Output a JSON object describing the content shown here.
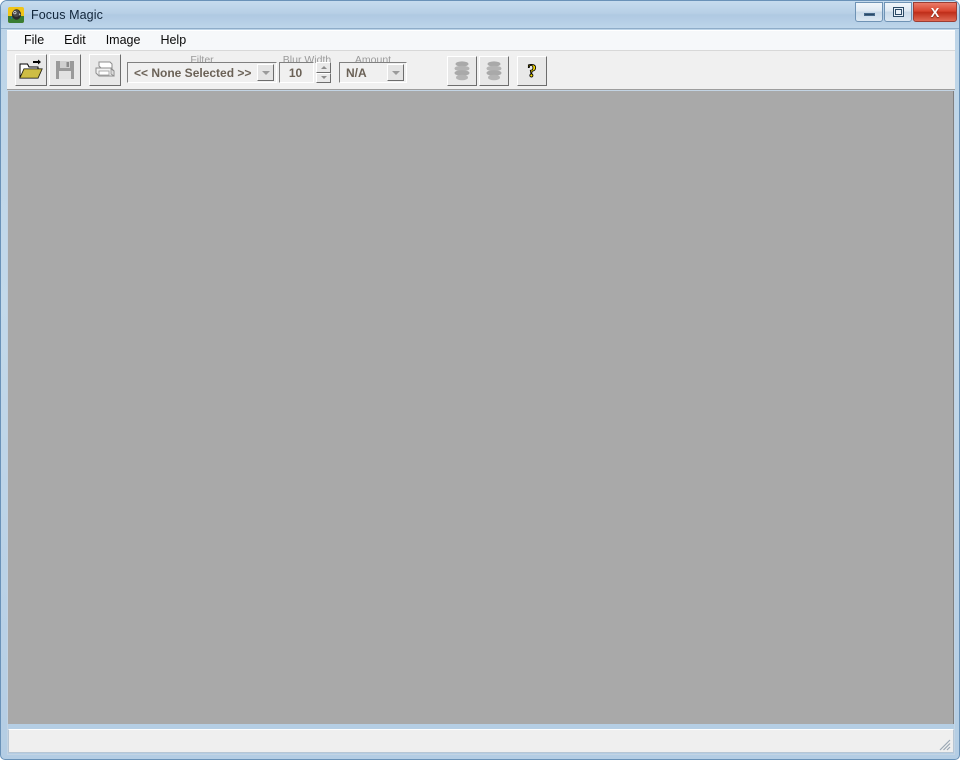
{
  "window": {
    "title": "Focus Magic",
    "app_icon": "parrot-app-icon",
    "controls": {
      "minimize_label": "Minimize",
      "maximize_label": "Maximize",
      "close_label": "X"
    }
  },
  "menubar": {
    "items": [
      {
        "label": "File"
      },
      {
        "label": "Edit"
      },
      {
        "label": "Image"
      },
      {
        "label": "Help"
      }
    ]
  },
  "toolbar": {
    "open_tooltip": "Open",
    "save_tooltip": "Save",
    "print_tooltip": "Print",
    "filter": {
      "label": "Filter",
      "value": "<< None Selected >>",
      "options": [
        "<< None Selected >>"
      ]
    },
    "blur_width": {
      "label": "Blur Width",
      "value": "10"
    },
    "amount": {
      "label": "Amount",
      "value": "N/A",
      "options": [
        "N/A"
      ]
    },
    "action_buttons": [
      {
        "name": "apply-stack-1"
      },
      {
        "name": "apply-stack-2"
      }
    ],
    "help": {
      "glyph": "?"
    }
  },
  "statusbar": {
    "text": ""
  },
  "colors": {
    "titlebar_blue": "#b7cfe6",
    "frame_blue": "#bcd4e8",
    "client_gray": "#a9a9a9",
    "toolbar_gray": "#f0f0f0",
    "close_red": "#d9452f",
    "icon_yellow": "#ffe200",
    "disabled_gray": "#9a9a9a",
    "field_text": "#6b6257"
  }
}
